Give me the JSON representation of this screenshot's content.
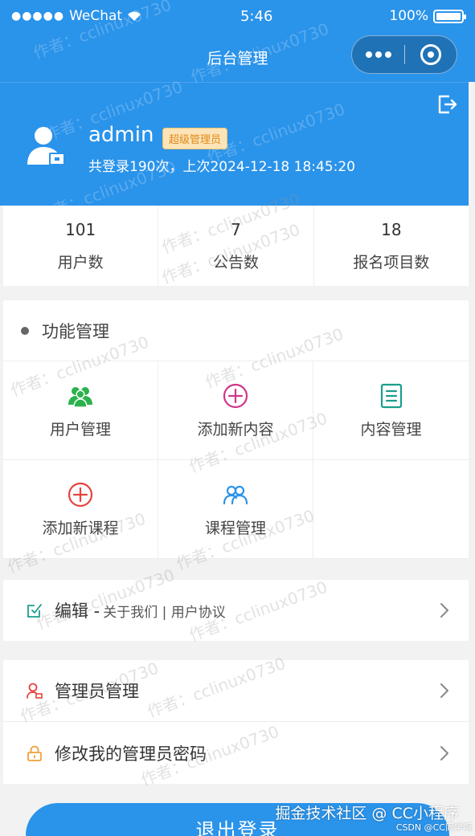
{
  "status_bar": {
    "carrier": "WeChat",
    "time": "5:46",
    "battery": "100%"
  },
  "nav": {
    "title": "后台管理"
  },
  "profile": {
    "username": "admin",
    "role_badge": "超级管理员",
    "login_info": "共登录190次，上次2024-12-18 18:45:20"
  },
  "stats": [
    {
      "value": "101",
      "label": "用户数"
    },
    {
      "value": "7",
      "label": "公告数"
    },
    {
      "value": "18",
      "label": "报名项目数"
    }
  ],
  "functions": {
    "title": "功能管理",
    "items": [
      {
        "label": "用户管理",
        "icon": "users-icon",
        "color": "#2bb24c"
      },
      {
        "label": "添加新内容",
        "icon": "plus-circle-icon",
        "color": "#d0368a"
      },
      {
        "label": "内容管理",
        "icon": "document-list-icon",
        "color": "#1a9e8c"
      },
      {
        "label": "添加新课程",
        "icon": "plus-circle-icon",
        "color": "#e64340"
      },
      {
        "label": "课程管理",
        "icon": "users-outline-icon",
        "color": "#2a93ea"
      }
    ]
  },
  "edit_row": {
    "main": "编辑 -",
    "sub": "关于我们 | 用户协议"
  },
  "admin_rows": [
    {
      "label": "管理员管理",
      "icon": "admin-user-icon"
    },
    {
      "label": "修改我的管理员密码",
      "icon": "lock-icon"
    }
  ],
  "logout_button": "退出登录",
  "watermark": "作者：cclinux0730",
  "footer": {
    "credit": "掘金技术社区 @ CC小程序",
    "csdn": "CSDN @CC同学啊"
  },
  "colors": {
    "primary": "#2a93ea",
    "badge_bg": "#fde4b8",
    "badge_text": "#e08a1a"
  }
}
